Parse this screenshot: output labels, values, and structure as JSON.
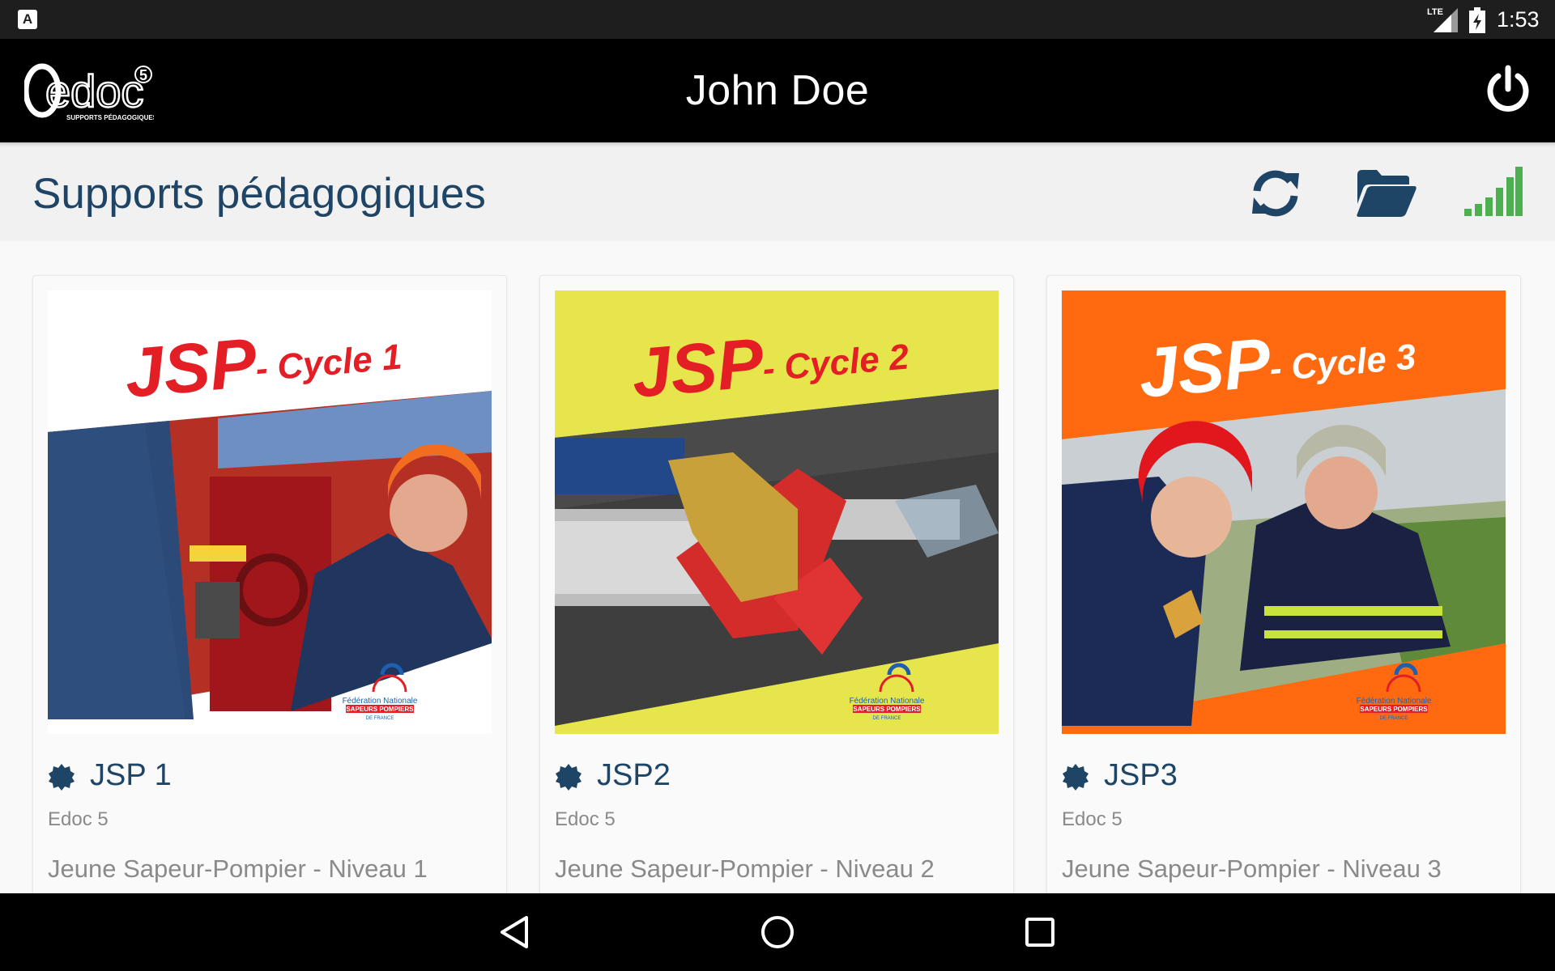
{
  "status_bar": {
    "notification_icon": "A",
    "network": "LTE",
    "time": "1:53",
    "icons": [
      "signal-icon",
      "battery-icon"
    ]
  },
  "app_bar": {
    "logo_text": "edoc",
    "logo_superscript": "5",
    "logo_tagline": "SUPPORTS PÉDAGOGIQUES",
    "user_name": "John Doe",
    "power_icon": "power-icon"
  },
  "toolbar": {
    "title": "Supports pédagogiques",
    "icons": [
      "sync-icon",
      "folder-open-icon",
      "signal-strength-icon"
    ],
    "colors": {
      "accent": "#1f4566",
      "signal": "#4caf50"
    }
  },
  "cards": [
    {
      "cover_title": "JSP",
      "cover_subtitle": "- Cycle 1",
      "cover_bg": "#ffffff",
      "cover_title_color": "#e31e24",
      "cover_badge_line1": "Fédération Nationale",
      "cover_badge_line2": "SAPEURS POMPIERS",
      "cover_badge_line3": "DE FRANCE",
      "title": "JSP 1",
      "publisher": "Edoc 5",
      "description": "Jeune Sapeur-Pompier - Niveau 1"
    },
    {
      "cover_title": "JSP",
      "cover_subtitle": "- Cycle 2",
      "cover_bg": "#e6e64c",
      "cover_title_color": "#e31e24",
      "cover_badge_line1": "Fédération Nationale",
      "cover_badge_line2": "SAPEURS POMPIERS",
      "cover_badge_line3": "DE FRANCE",
      "title": "JSP2",
      "publisher": "Edoc 5",
      "description": "Jeune Sapeur-Pompier - Niveau 2"
    },
    {
      "cover_title": "JSP",
      "cover_subtitle": "- Cycle 3",
      "cover_bg": "#ff6a10",
      "cover_title_color": "#ffffff",
      "cover_badge_line1": "Fédération Nationale",
      "cover_badge_line2": "SAPEURS POMPIERS",
      "cover_badge_line3": "DE FRANCE",
      "title": "JSP3",
      "publisher": "Edoc 5",
      "description": "Jeune Sapeur-Pompier - Niveau 3"
    }
  ],
  "nav_bar": {
    "buttons": [
      "back-icon",
      "home-icon",
      "recents-icon"
    ]
  }
}
